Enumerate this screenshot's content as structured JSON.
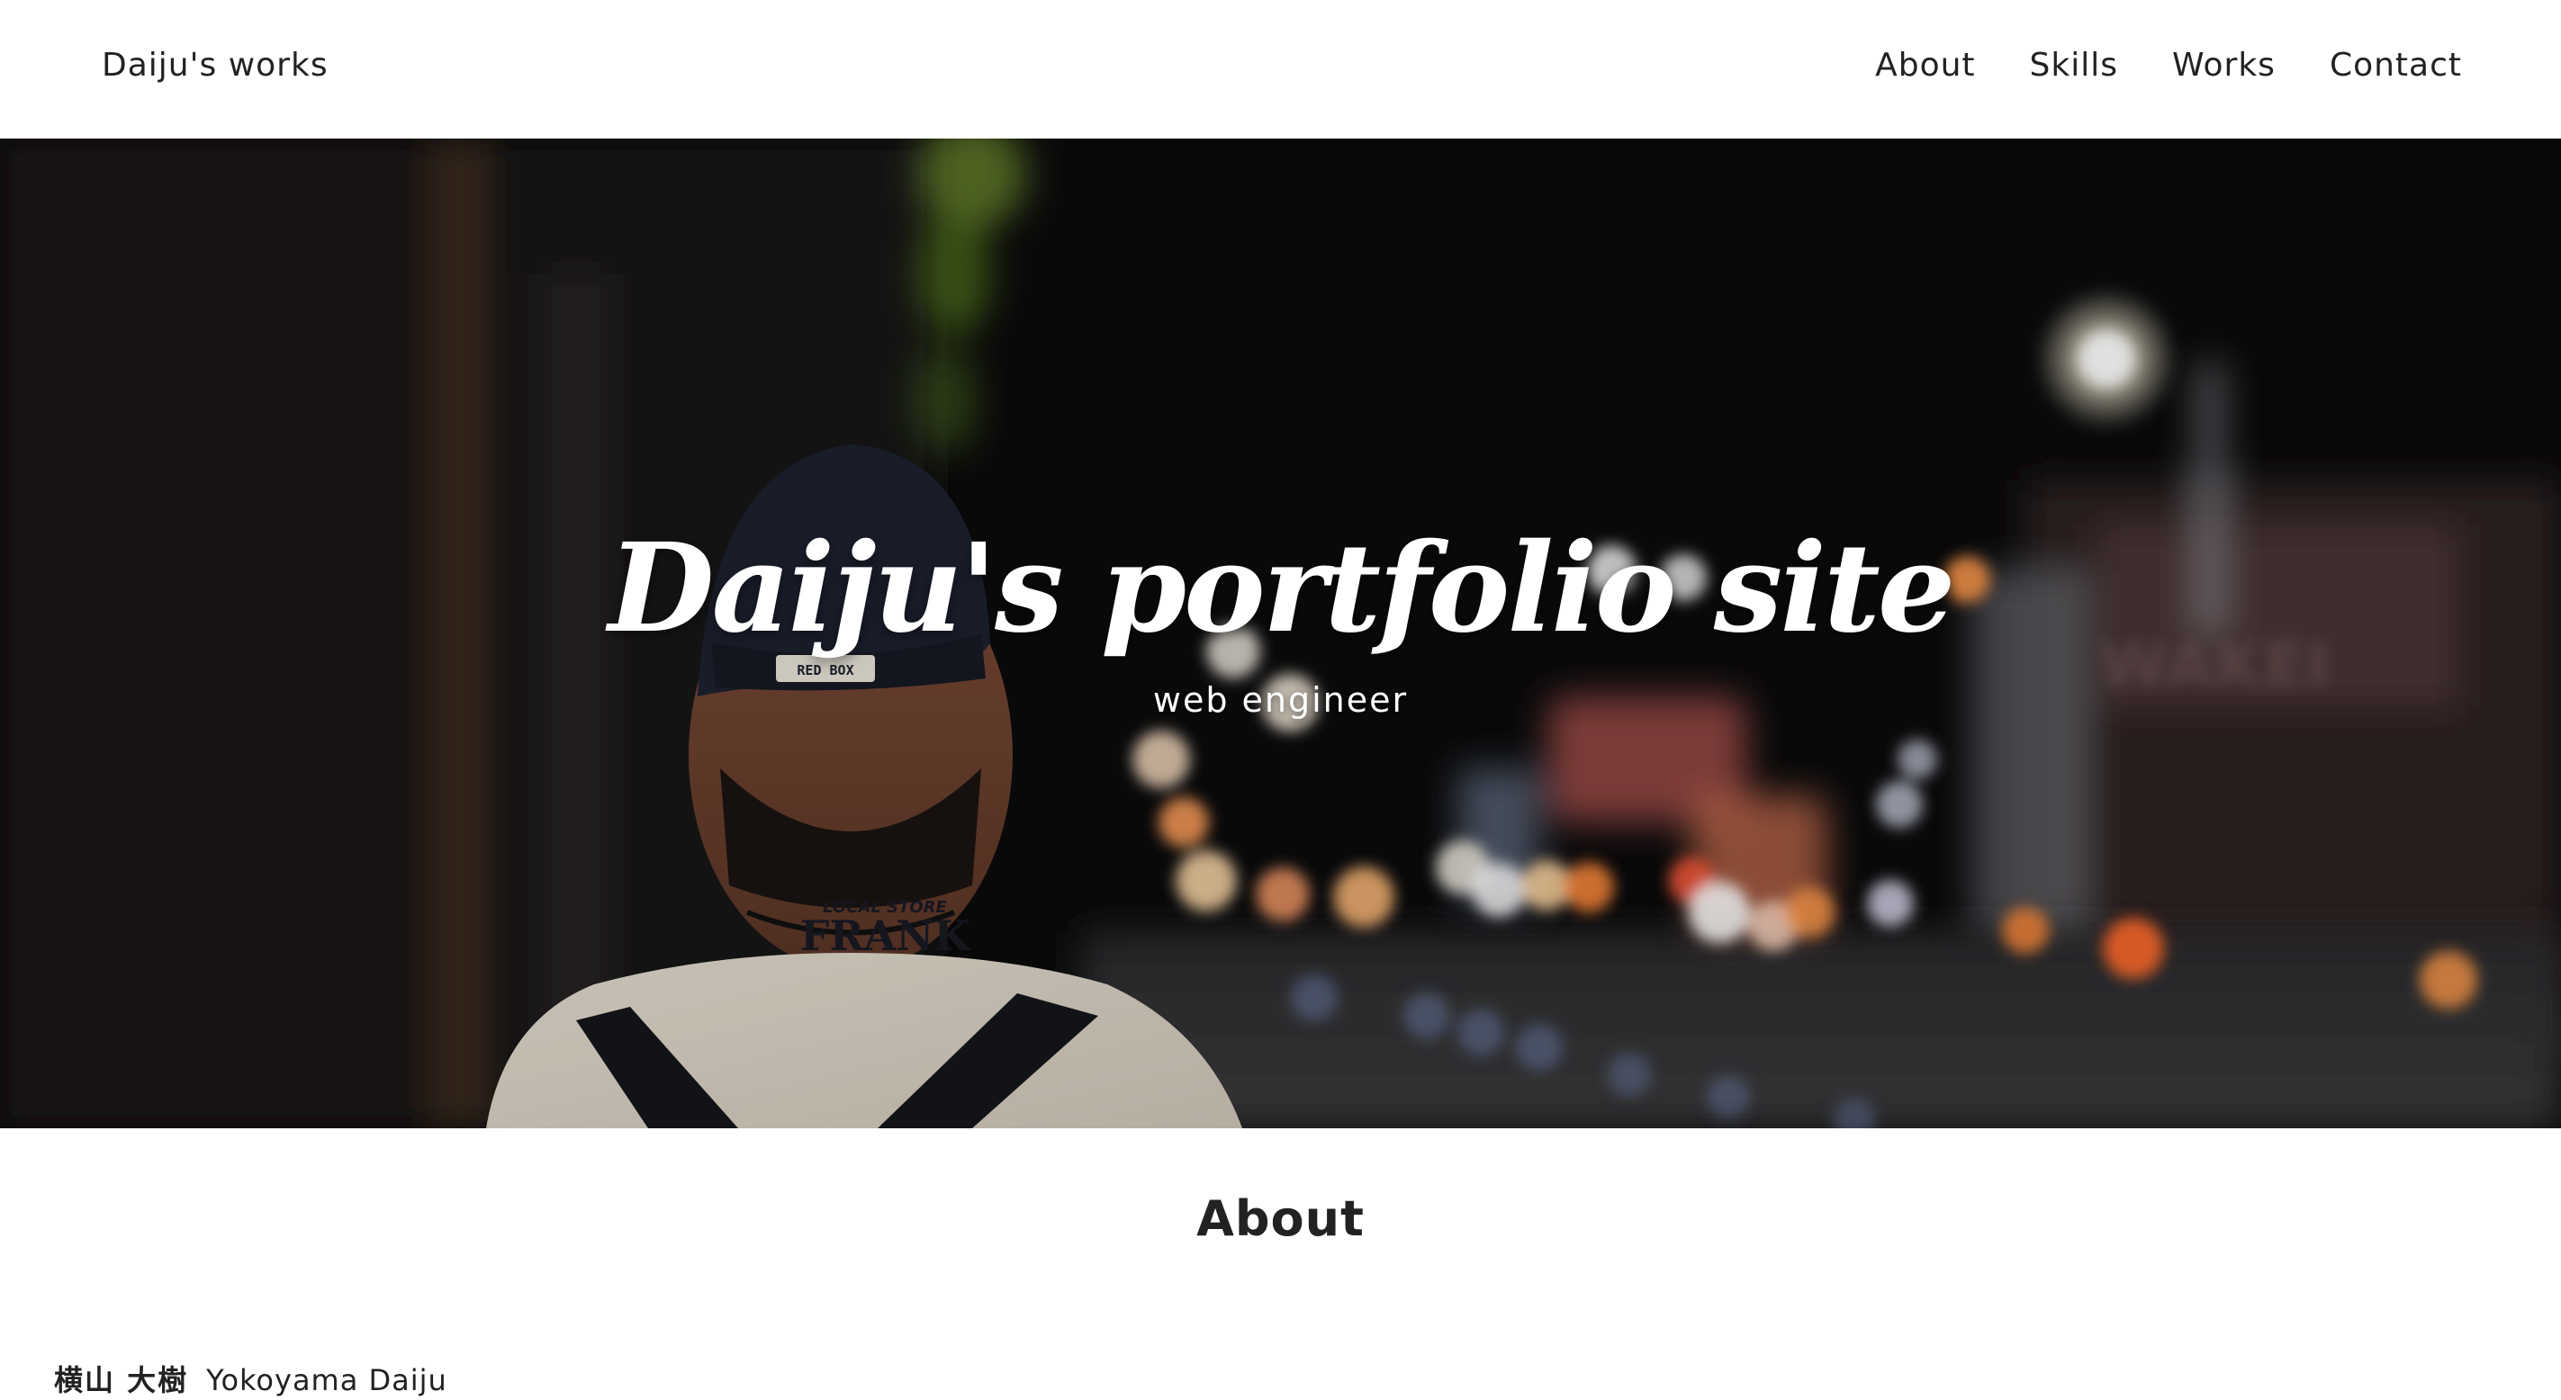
{
  "header": {
    "brand": "Daiju's works",
    "nav": [
      {
        "label": "About"
      },
      {
        "label": "Skills"
      },
      {
        "label": "Works"
      },
      {
        "label": "Contact"
      }
    ]
  },
  "hero": {
    "title": "Daiju's portfolio site",
    "subtitle": "web engineer",
    "shirt_text": "FRANK",
    "shirt_small_text": "LOCAL STORE",
    "cap_text": "RED BOX",
    "truck_sign": "WAKEI"
  },
  "about": {
    "heading": "About",
    "name_jp": "横山 大樹",
    "name_en": "Yokoyama Daiju"
  },
  "colors": {
    "header_bg": "#ffffff",
    "text": "#222222",
    "hero_bg": "#0b0b0c",
    "hero_text": "#ffffff"
  }
}
